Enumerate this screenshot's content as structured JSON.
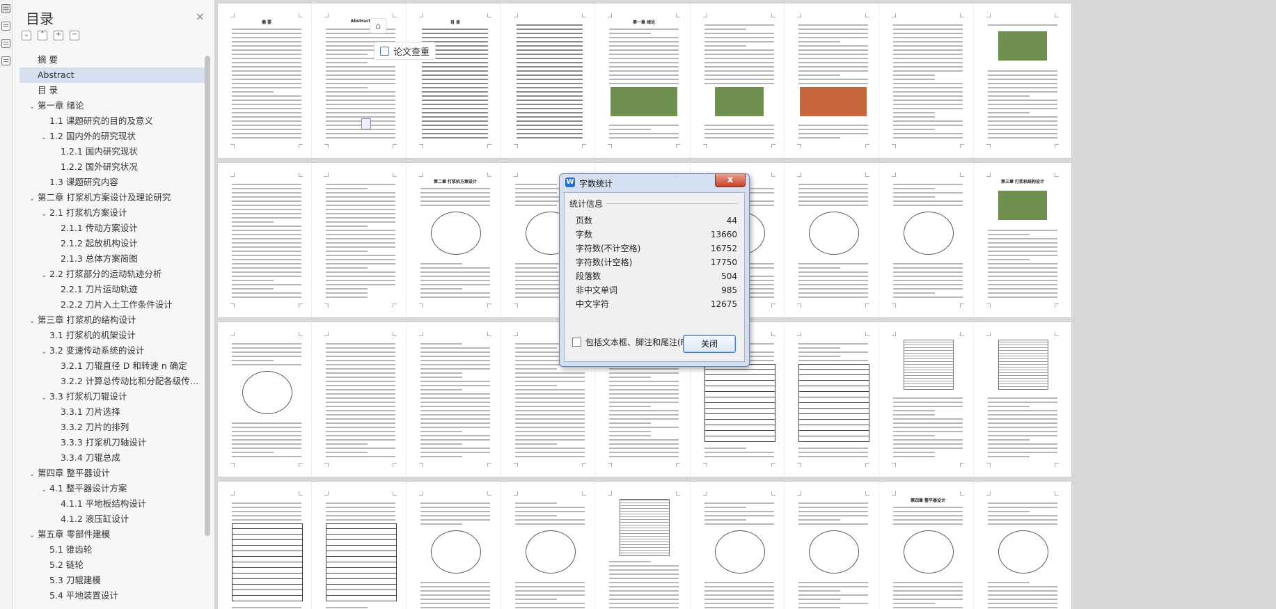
{
  "toc": {
    "title": "目录",
    "close_glyph": "×",
    "tools": [
      "⌄",
      "⌃",
      "+",
      "−"
    ],
    "items": [
      {
        "label": "摘  要",
        "level": 0,
        "caret": "",
        "selected": false
      },
      {
        "label": "Abstract",
        "level": 0,
        "caret": "",
        "selected": true
      },
      {
        "label": "目  录",
        "level": 0,
        "caret": "",
        "selected": false
      },
      {
        "label": "第一章 绪论",
        "level": 0,
        "caret": "⌄",
        "selected": false
      },
      {
        "label": "1.1 课题研究的目的及意义",
        "level": 1,
        "caret": "",
        "selected": false
      },
      {
        "label": "1.2 国内外的研究现状",
        "level": 1,
        "caret": "⌄",
        "selected": false
      },
      {
        "label": "1.2.1 国内研究现状",
        "level": 2,
        "caret": "",
        "selected": false
      },
      {
        "label": "1.2.2 国外研究状况",
        "level": 2,
        "caret": "",
        "selected": false
      },
      {
        "label": "1.3 课题研究内容",
        "level": 1,
        "caret": "",
        "selected": false
      },
      {
        "label": "第二章 打浆机方案设计及理论研究",
        "level": 0,
        "caret": "⌄",
        "selected": false
      },
      {
        "label": "2.1 打浆机方案设计",
        "level": 1,
        "caret": "⌄",
        "selected": false
      },
      {
        "label": "2.1.1 传动方案设计",
        "level": 2,
        "caret": "",
        "selected": false
      },
      {
        "label": "2.1.2 起放机构设计",
        "level": 2,
        "caret": "",
        "selected": false
      },
      {
        "label": "2.1.3 总体方案简图",
        "level": 2,
        "caret": "",
        "selected": false
      },
      {
        "label": "2.2 打浆部分的运动轨迹分析",
        "level": 1,
        "caret": "⌄",
        "selected": false
      },
      {
        "label": "2.2.1 刀片运动轨迹",
        "level": 2,
        "caret": "",
        "selected": false
      },
      {
        "label": "2.2.2 刀片入土工作条件设计",
        "level": 2,
        "caret": "",
        "selected": false
      },
      {
        "label": "第三章 打浆机的结构设计",
        "level": 0,
        "caret": "⌄",
        "selected": false
      },
      {
        "label": "3.1 打浆机的机架设计",
        "level": 1,
        "caret": "",
        "selected": false
      },
      {
        "label": "3.2 变速传动系统的设计",
        "level": 1,
        "caret": "⌄",
        "selected": false
      },
      {
        "label": "3.2.1 刀辊直径 D 和转速 n 确定",
        "level": 2,
        "caret": "",
        "selected": false
      },
      {
        "label": "3.2.2 计算总传动比和分配各级传…",
        "level": 2,
        "caret": "",
        "selected": false
      },
      {
        "label": "3.3 打浆机刀辊设计",
        "level": 1,
        "caret": "⌄",
        "selected": false
      },
      {
        "label": "3.3.1 刀片选择",
        "level": 2,
        "caret": "",
        "selected": false
      },
      {
        "label": "3.3.2 刀片的排列",
        "level": 2,
        "caret": "",
        "selected": false
      },
      {
        "label": "3.3.3   打浆机刀轴设计",
        "level": 2,
        "caret": "",
        "selected": false
      },
      {
        "label": "3.3.4 刀辊总成",
        "level": 2,
        "caret": "",
        "selected": false
      },
      {
        "label": "第四章 整平器设计",
        "level": 0,
        "caret": "⌄",
        "selected": false
      },
      {
        "label": "4.1 整平器设计方案",
        "level": 1,
        "caret": "⌄",
        "selected": false
      },
      {
        "label": "4.1.1 平地板结构设计",
        "level": 2,
        "caret": "",
        "selected": false
      },
      {
        "label": "4.1.2 液压缸设计",
        "level": 2,
        "caret": "",
        "selected": false
      },
      {
        "label": "第五章 零部件建模",
        "level": 0,
        "caret": "⌄",
        "selected": false
      },
      {
        "label": "5.1 锥齿轮",
        "level": 1,
        "caret": "",
        "selected": false
      },
      {
        "label": "5.2 链轮",
        "level": 1,
        "caret": "",
        "selected": false
      },
      {
        "label": "5.3 刀辊建模",
        "level": 1,
        "caret": "",
        "selected": false
      },
      {
        "label": "5.4 平地装置设计",
        "level": 1,
        "caret": "",
        "selected": false
      }
    ]
  },
  "document": {
    "paper_check_label": "论文查重",
    "pages": [
      {
        "hdr": "摘  要",
        "kind": "text"
      },
      {
        "hdr": "Abstract",
        "kind": "text"
      },
      {
        "hdr": "目  录",
        "kind": "toc"
      },
      {
        "hdr": "",
        "kind": "toc"
      },
      {
        "hdr": "第一章 绪论",
        "kind": "photo2"
      },
      {
        "hdr": "",
        "kind": "photo1"
      },
      {
        "hdr": "",
        "kind": "photo3"
      },
      {
        "hdr": "",
        "kind": "text"
      },
      {
        "hdr": "",
        "kind": "photo4"
      },
      {
        "hdr": "",
        "kind": "text"
      },
      {
        "hdr": "",
        "kind": "text"
      },
      {
        "hdr": "第二章 打浆机方案设计",
        "kind": "diag"
      },
      {
        "hdr": "",
        "kind": "diag"
      },
      {
        "hdr": "",
        "kind": "diag"
      },
      {
        "hdr": "",
        "kind": "diag"
      },
      {
        "hdr": "",
        "kind": "diag"
      },
      {
        "hdr": "",
        "kind": "diag"
      },
      {
        "hdr": "第三章 打浆机结构设计",
        "kind": "photo5"
      },
      {
        "hdr": "",
        "kind": "diag"
      },
      {
        "hdr": "",
        "kind": "text"
      },
      {
        "hdr": "",
        "kind": "text"
      },
      {
        "hdr": "",
        "kind": "text"
      },
      {
        "hdr": "",
        "kind": "text"
      },
      {
        "hdr": "",
        "kind": "table"
      },
      {
        "hdr": "",
        "kind": "table"
      },
      {
        "hdr": "",
        "kind": "chart"
      },
      {
        "hdr": "",
        "kind": "chart"
      },
      {
        "hdr": "",
        "kind": "table"
      },
      {
        "hdr": "",
        "kind": "table"
      },
      {
        "hdr": "",
        "kind": "diag"
      },
      {
        "hdr": "",
        "kind": "diag"
      },
      {
        "hdr": "",
        "kind": "grid"
      },
      {
        "hdr": "",
        "kind": "diag"
      },
      {
        "hdr": "",
        "kind": "diag"
      },
      {
        "hdr": "第四章 整平器设计",
        "kind": "diag"
      },
      {
        "hdr": "",
        "kind": "diag"
      }
    ]
  },
  "dialog": {
    "title": "字数统计",
    "close_glyph": "x",
    "group_label": "统计信息",
    "stats": [
      {
        "label": "页数",
        "value": "44"
      },
      {
        "label": "字数",
        "value": "13660"
      },
      {
        "label": "字符数(不计空格)",
        "value": "16752"
      },
      {
        "label": "字符数(计空格)",
        "value": "17750"
      },
      {
        "label": "段落数",
        "value": "504"
      },
      {
        "label": "非中文单词",
        "value": "985"
      },
      {
        "label": "中文字符",
        "value": "12675"
      }
    ],
    "checkbox_label": "包括文本框、脚注和尾注(F)",
    "checkbox_checked": false,
    "close_button": "关闭"
  },
  "colors": {
    "toc_selected": "#d5dff0",
    "dialog_frame": "#d4e0f2",
    "close_red": "#c5412c",
    "accent": "#2c6fd0"
  }
}
